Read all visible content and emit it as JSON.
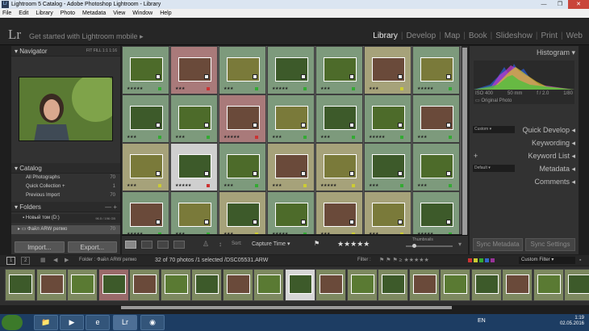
{
  "window": {
    "title": "Lightroom 5 Catalog - Adobe Photoshop Lightroom - Library"
  },
  "menu": [
    "File",
    "Edit",
    "Library",
    "Photo",
    "Metadata",
    "View",
    "Window",
    "Help"
  ],
  "header": {
    "logo": "Lr",
    "mobile_text": "Get started with Lightroom mobile",
    "modules": [
      "Library",
      "Develop",
      "Map",
      "Book",
      "Slideshow",
      "Print",
      "Web"
    ],
    "active": "Library"
  },
  "left": {
    "navigator": "Navigator",
    "nav_options": "FIT   FILL   1:1   1:16",
    "catalog": "Catalog",
    "catalog_items": [
      {
        "label": "All Photographs",
        "count": "70"
      },
      {
        "label": "Quick Collection +",
        "count": "1"
      },
      {
        "label": "Previous Import",
        "count": "70"
      }
    ],
    "folders": "Folders",
    "volume": {
      "label": "Новый том (D:)",
      "size": "96.5 / 196 GB"
    },
    "folder": {
      "label": "Файл ARW репмо",
      "count": "70"
    },
    "import": "Import...",
    "export": "Export..."
  },
  "grid": {
    "colors": [
      "#a97a7a",
      "#7d9a7c",
      "#a6a27a",
      "#8c8c8c",
      "#7d8960",
      "#ccc"
    ]
  },
  "toolbar": {
    "sort_label": "Sort:",
    "sort_value": "Capture Time",
    "stars": "★★★★★",
    "thumbnails": "Thumbnails"
  },
  "right": {
    "histogram": "Histogram",
    "iso": "ISO 400",
    "mm": "50 mm",
    "f": "f / 2.0",
    "shutter": "1/80",
    "original": "Original Photo",
    "quick_develop": "Quick Develop",
    "custom": "Custom",
    "keywording": "Keywording",
    "keyword_list": "Keyword List",
    "metadata": "Metadata",
    "metadata_preset": "Default",
    "comments": "Comments",
    "sync_metadata": "Sync Metadata",
    "sync_settings": "Sync Settings"
  },
  "filmstrip": {
    "path": "Folder : Файл ARW репмо",
    "count": "32 of 70 photos /1 selected /DSC05531.ARW",
    "filter_label": "Filter :",
    "filter_value": "Custom Filter"
  },
  "taskbar": {
    "lang": "EN",
    "time": "1:19",
    "date": "02.05.2016"
  }
}
